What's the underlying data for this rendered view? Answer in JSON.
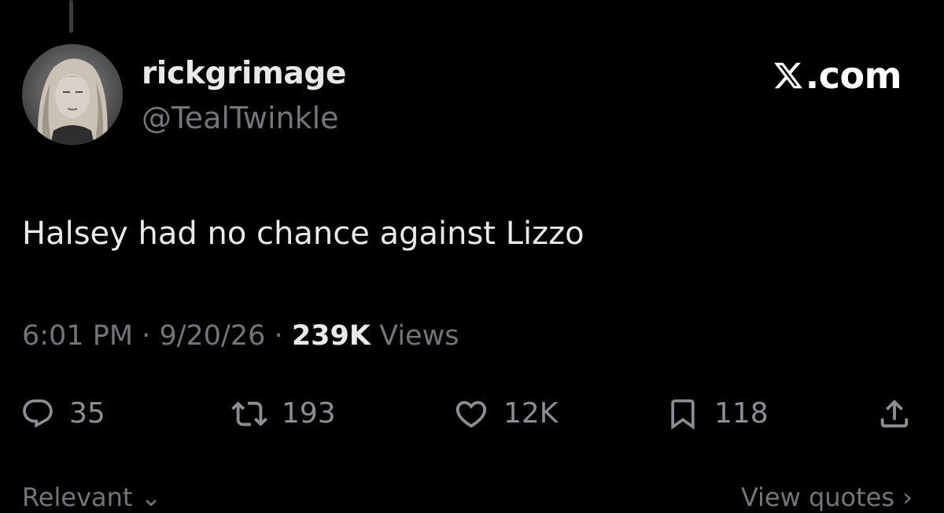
{
  "user": {
    "display_name": "rickgrimage",
    "handle": "@TealTwinkle"
  },
  "brand": {
    "text": ".com",
    "logo_icon": "x-logo-icon"
  },
  "tweet": {
    "text": "Halsey had no chance against Lizzo"
  },
  "meta": {
    "time": "6:01 PM",
    "date": "9/20/26",
    "views_count": "239K",
    "views_label": "Views",
    "separator": "·"
  },
  "actions": {
    "replies": {
      "icon": "reply-icon",
      "count": "35"
    },
    "reposts": {
      "icon": "repost-icon",
      "count": "193"
    },
    "likes": {
      "icon": "heart-icon",
      "count": "12K"
    },
    "bookmarks": {
      "icon": "bookmark-icon",
      "count": "118"
    },
    "share": {
      "icon": "share-icon"
    }
  },
  "footer": {
    "left_label": "Relevant",
    "left_chevron": "⌄",
    "right_label": "View quotes",
    "right_chevron": "›"
  },
  "colors": {
    "background": "#000000",
    "primary_text": "#e7e9ea",
    "secondary_text": "#71767b"
  }
}
